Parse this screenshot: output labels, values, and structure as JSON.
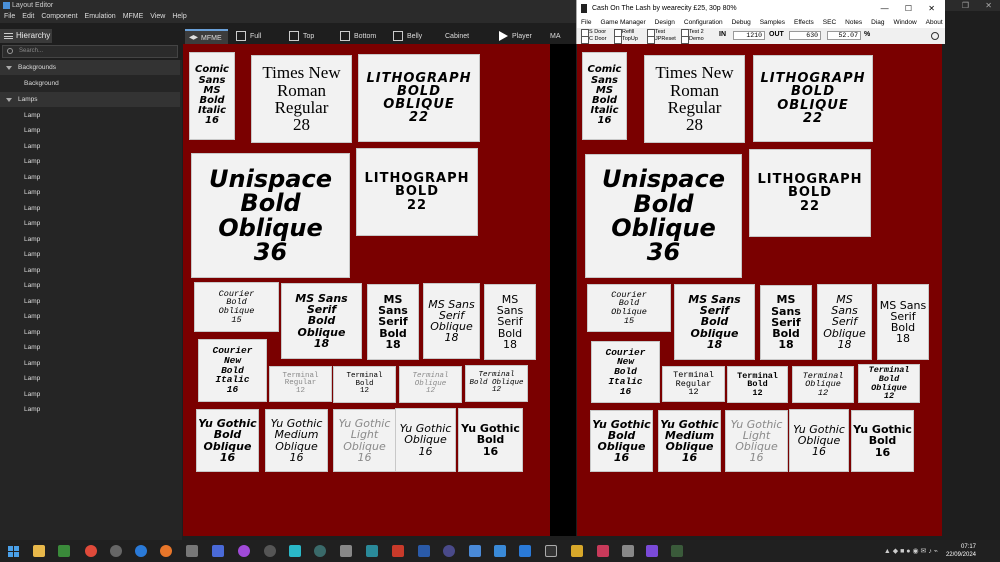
{
  "layout_editor": {
    "title": "Layout Editor",
    "menu": [
      "File",
      "Edit",
      "Component",
      "Emulation",
      "MFME",
      "View",
      "Help"
    ],
    "hierarchy_title": "Hierarchy",
    "search_placeholder": "Search...",
    "tree": {
      "backgrounds_label": "Backgrounds",
      "background_item": "Background",
      "lamps_label": "Lamps",
      "lamp_item": "Lamp",
      "lamp_count": 20
    },
    "tabs": {
      "mfme": "MFME",
      "full": "Full",
      "top": "Top",
      "bottom": "Bottom",
      "belly": "Belly",
      "cabinet": "Cabinet",
      "player": "Player",
      "ma": "MA"
    }
  },
  "mfme_window": {
    "title": "Cash On The Lash by wearecity £25, 30p 80%",
    "menu": [
      "File",
      "Game Manager",
      "Design",
      "Configuration",
      "Debug",
      "Samples",
      "Effects",
      "SEC",
      "Notes",
      "Diag",
      "Window",
      "About"
    ],
    "checks": {
      "s_door": "S Door",
      "c_door": "C Door",
      "refill": "Refill",
      "topup": "TopUp",
      "test": "Test",
      "jpreset": "JPReset",
      "test2": "Test 2",
      "demo": "Demo"
    },
    "in_label": "IN",
    "in_value": "1210",
    "out_label": "OUT",
    "out_value": "630",
    "percent_value": "52.07",
    "percent_sign": "%"
  },
  "font_panels": [
    {
      "text": "Comic\nSans\nMS\nBold\nItalic\n16"
    },
    {
      "text": "Times New\nRoman\nRegular\n28"
    },
    {
      "text": "LITHOGRAPH\nBOLD\nOBLIQUE\n22"
    },
    {
      "text": "Unispace\nBold\nOblique\n36"
    },
    {
      "text": "LITHOGRAPH\nBOLD\n22"
    },
    {
      "text": "Courier\nBold\nOblique\n15"
    },
    {
      "text": "MS Sans\nSerif\nBold Oblique\n18"
    },
    {
      "text": "MS\nSans\nSerif\nBold\n18"
    },
    {
      "text": "MS Sans\nSerif\nOblique\n18"
    },
    {
      "text": "MS\nSans\nSerif\nBold\n18"
    },
    {
      "text": "Courier\nNew\nBold\nItalic\n16"
    },
    {
      "text": "Terminal\nRegular\n12"
    },
    {
      "text": "Terminal\nBold\n12"
    },
    {
      "text": "Terminal\nOblique\n12"
    },
    {
      "text": "Terminal\nBold Oblique\n12"
    },
    {
      "text": "Yu Gothic\nBold\nOblique\n16"
    },
    {
      "text": "Yu Gothic\nMedium\nOblique\n16"
    },
    {
      "text": "Yu Gothic\nLight\nOblique\n16"
    },
    {
      "text": "Yu Gothic\nOblique\n16"
    },
    {
      "text": "Yu Gothic\nBold\n16"
    }
  ],
  "right_panels": [
    {
      "text": "Comic\nSans\nMS\nBold\nItalic\n16"
    },
    {
      "text": "Times New\nRoman\nRegular\n28"
    },
    {
      "text": "LITHOGRAPH\nBOLD\nOBLIQUE\n22"
    },
    {
      "text": "Unispace\nBold\nOblique\n36"
    },
    {
      "text": "LITHOGRAPH\nBOLD\n22"
    },
    {
      "text": "Courier\nBold\nOblique\n15"
    },
    {
      "text": "MS Sans\nSerif\nBold\nOblique\n18"
    },
    {
      "text": "MS\nSans\nSerif\nBold\n18"
    },
    {
      "text": "MS\nSans\nSerif\nOblique\n18"
    },
    {
      "text": "MS Sans\nSerif\nBold\n18"
    },
    {
      "text": "Courier\nNew\nBold\nItalic\n16"
    },
    {
      "text": "Terminal\nRegular\n12"
    },
    {
      "text": "Terminal\nBold\n12"
    },
    {
      "text": "Terminal\nOblique\n12"
    },
    {
      "text": "Terminal\nBold\nOblique\n12"
    },
    {
      "text": "Yu Gothic\nBold\nOblique\n16"
    },
    {
      "text": "Yu Gothic\nMedium\nOblique\n16"
    },
    {
      "text": "Yu Gothic\nLight\nOblique\n16"
    },
    {
      "text": "Yu Gothic\nOblique\n16"
    },
    {
      "text": "Yu Gothic\nBold\n16"
    }
  ],
  "taskbar": {
    "time": "07:17",
    "date": "22/09/2024"
  },
  "colors": {
    "canvas_bg": "#7a0000",
    "panel_bg": "#f2f2f2",
    "editor_bg": "#1e1e1e"
  }
}
